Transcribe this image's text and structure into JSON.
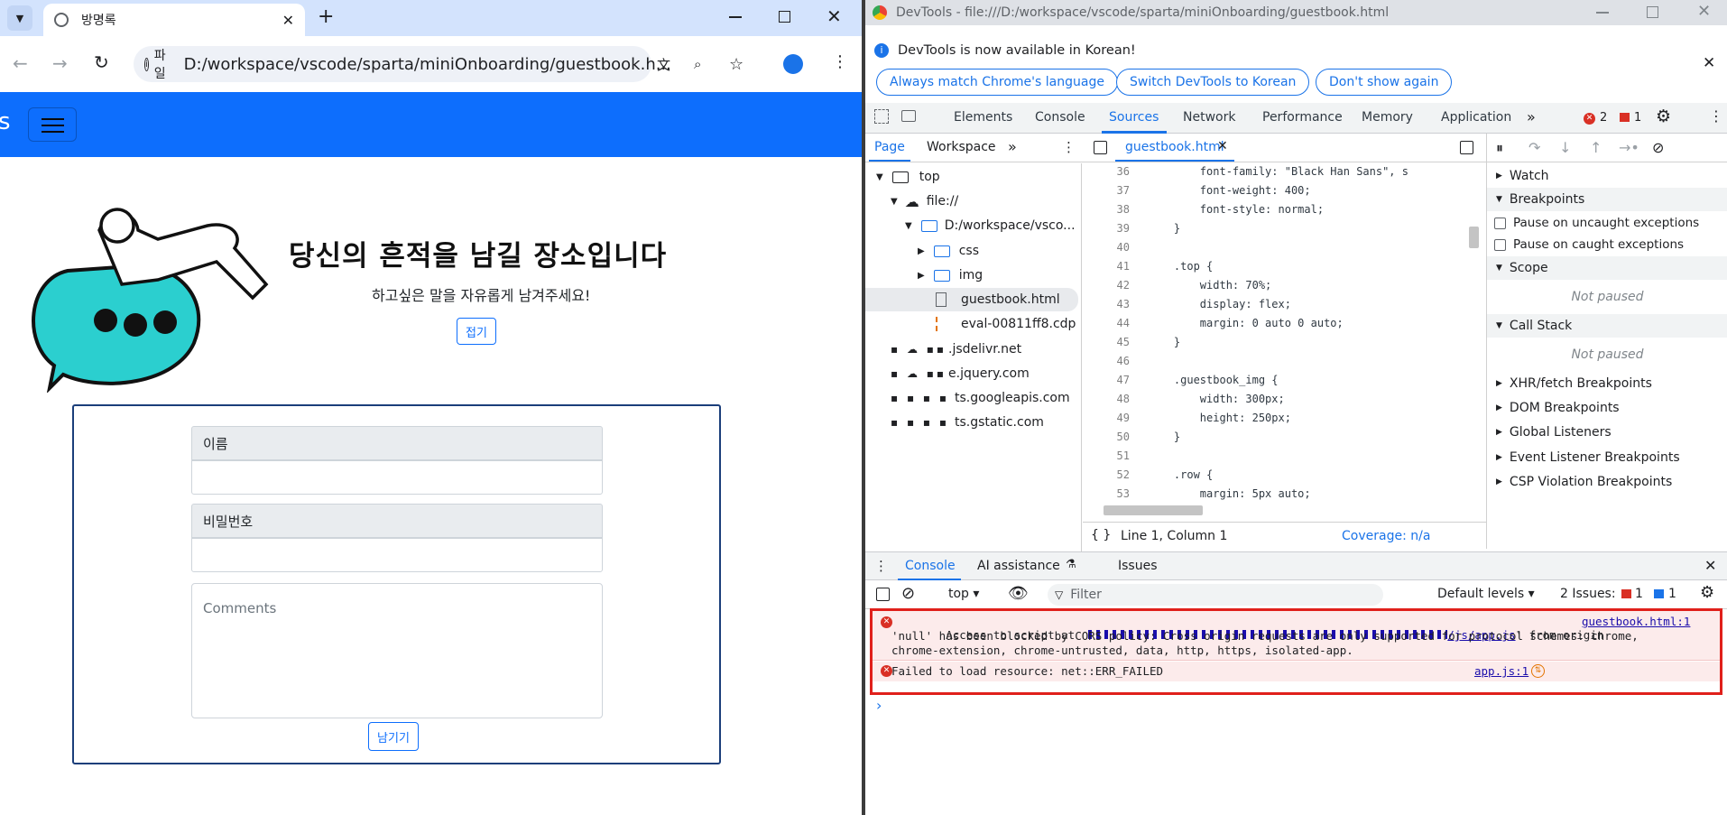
{
  "browser": {
    "tab_title": "방명록",
    "address_chip": "파일",
    "url": "D:/workspace/vscode/sparta/miniOnboarding/guestbook.h..."
  },
  "page": {
    "nav_brand_fragment": "s",
    "hero_title": "당신의 흔적을 남길 장소입니다",
    "hero_subtitle": "하고싶은 말을 자유롭게 남겨주세요!",
    "fold_button": "접기",
    "name_label": "이름",
    "password_label": "비밀번호",
    "comments_placeholder": "Comments",
    "submit_button": "남기기"
  },
  "devtools": {
    "window_title": "DevTools - file:///D:/workspace/vscode/sparta/miniOnboarding/guestbook.html",
    "notice": "DevTools is now available in Korean!",
    "notice_buttons": [
      "Always match Chrome's language",
      "Switch DevTools to Korean",
      "Don't show again"
    ],
    "tabs": [
      "Elements",
      "Console",
      "Sources",
      "Network",
      "Performance",
      "Memory",
      "Application"
    ],
    "error_count": "2",
    "issue_count": "1",
    "left_tabs": [
      "Page",
      "Workspace"
    ],
    "file_tab": "guestbook.html",
    "tree": {
      "top": "top",
      "file": "file://",
      "folder": "D:/workspace/vsco...",
      "css": "css",
      "img": "img",
      "guestbook": "guestbook.html",
      "eval": "eval-00811ff8.cdp",
      "host1": ".jsdelivr.net",
      "host2": "e.jquery.com",
      "host3": "ts.googleapis.com",
      "host4": "ts.gstatic.com"
    },
    "code_lines": [
      {
        "n": "36",
        "t": "        font-family: \"Black Han Sans\", s"
      },
      {
        "n": "37",
        "t": "        font-weight: 400;"
      },
      {
        "n": "38",
        "t": "        font-style: normal;"
      },
      {
        "n": "39",
        "t": "    }"
      },
      {
        "n": "40",
        "t": ""
      },
      {
        "n": "41",
        "t": "    .top {"
      },
      {
        "n": "42",
        "t": "        width: 70%;"
      },
      {
        "n": "43",
        "t": "        display: flex;"
      },
      {
        "n": "44",
        "t": "        margin: 0 auto 0 auto;"
      },
      {
        "n": "45",
        "t": "    }"
      },
      {
        "n": "46",
        "t": ""
      },
      {
        "n": "47",
        "t": "    .guestbook_img {"
      },
      {
        "n": "48",
        "t": "        width: 300px;"
      },
      {
        "n": "49",
        "t": "        height: 250px;"
      },
      {
        "n": "50",
        "t": "    }"
      },
      {
        "n": "51",
        "t": ""
      },
      {
        "n": "52",
        "t": "    .row {"
      },
      {
        "n": "53",
        "t": "        margin: 5px auto;"
      }
    ],
    "cursor_status": "Line 1, Column 1",
    "coverage": "Coverage: n/a",
    "sidebar": {
      "watch": "Watch",
      "breakpoints": "Breakpoints",
      "pause_uncaught": "Pause on uncaught exceptions",
      "pause_caught": "Pause on caught exceptions",
      "scope": "Scope",
      "not_paused_1": "Not paused",
      "call_stack": "Call Stack",
      "not_paused_2": "Not paused",
      "xhr": "XHR/fetch Breakpoints",
      "dom": "DOM Breakpoints",
      "global": "Global Listeners",
      "event": "Event Listener Breakpoints",
      "csp": "CSP Violation Breakpoints"
    },
    "drawer_tabs": [
      "Console",
      "AI assistance",
      "Issues"
    ],
    "context": "top",
    "filter_placeholder": "Filter",
    "levels": "Default levels",
    "issues_label": "2 Issues:",
    "issues_err": "1",
    "issues_info": "1",
    "errors": {
      "line1_prefix": "Access to script at",
      "line1_link": "/js/app.js",
      "line1_mid": "' from origin",
      "line1_src": "guestbook.html:1",
      "line2": "'null' has been blocked by CORS policy: Cross origin requests are only supported for protocol schemes: chrome,",
      "line3": "chrome-extension, chrome-untrusted, data, http, https, isolated-app.",
      "line4": "Failed to load resource: net::ERR_FAILED",
      "line4_src": "app.js:1"
    },
    "prompt": "›"
  }
}
